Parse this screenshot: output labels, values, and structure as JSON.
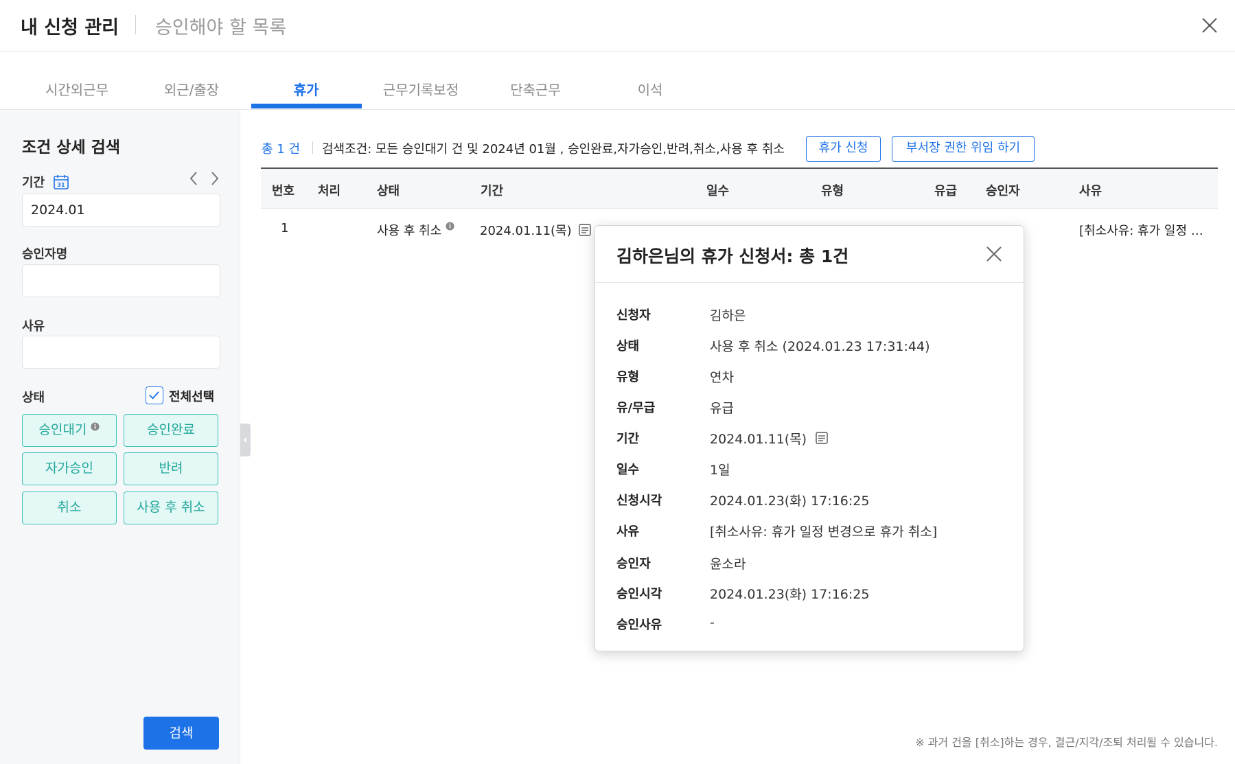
{
  "header": {
    "title": "내 신청 관리",
    "subtitle": "승인해야 할 목록"
  },
  "tabs": [
    {
      "label": "시간외근무"
    },
    {
      "label": "외근/출장"
    },
    {
      "label": "휴가"
    },
    {
      "label": "근무기록보정"
    },
    {
      "label": "단축근무"
    },
    {
      "label": "이석"
    }
  ],
  "sidebar": {
    "title": "조건 상세 검색",
    "period_label": "기간",
    "period_value": "2024.01",
    "approver_label": "승인자명",
    "approver_value": "",
    "reason_label": "사유",
    "reason_value": "",
    "status_label": "상태",
    "select_all_label": "전체선택",
    "status_buttons": [
      "승인대기",
      "승인완료",
      "자가승인",
      "반려",
      "취소",
      "사용 후 취소"
    ],
    "search_label": "검색"
  },
  "summary": {
    "total": "총 1 건",
    "conditions": "검색조건: 모든 승인대기 건 및 2024년 01월 , 승인완료,자가승인,반려,취소,사용 후 취소",
    "leave_request_button": "휴가 신청",
    "delegate_button": "부서장 권한 위임 하기"
  },
  "table": {
    "columns": [
      "번호",
      "처리",
      "상태",
      "기간",
      "일수",
      "유형",
      "유급",
      "승인자",
      "사유"
    ],
    "rows": [
      {
        "no": "1",
        "process": "",
        "status": "사용 후 취소",
        "period": "2024.01.11(목)",
        "reason": "[취소사유: 휴가 일정 …"
      }
    ]
  },
  "footnote": "※ 과거 건을 [취소]하는 경우, 결근/지각/조퇴 처리될 수 있습니다.",
  "modal": {
    "title": "김하은님의 휴가 신청서: 총 1건",
    "fields": [
      {
        "key": "신청자",
        "value": "김하은"
      },
      {
        "key": "상태",
        "value": "사용 후 취소 (2024.01.23 17:31:44)"
      },
      {
        "key": "유형",
        "value": "연차"
      },
      {
        "key": "유/무급",
        "value": "유급"
      },
      {
        "key": "기간",
        "value": "2024.01.11(목)"
      },
      {
        "key": "일수",
        "value": "1일"
      },
      {
        "key": "신청시각",
        "value": "2024.01.23(화) 17:16:25"
      },
      {
        "key": "사유",
        "value": "[취소사유: 휴가 일정 변경으로 휴가 취소]"
      },
      {
        "key": "승인자",
        "value": "윤소라"
      },
      {
        "key": "승인시각",
        "value": "2024.01.23(화) 17:16:25"
      },
      {
        "key": "승인사유",
        "value": "-"
      }
    ]
  },
  "colors": {
    "accent": "#1d72e8",
    "teal": "#3cc3b7",
    "teal_bg": "#e4f8f6"
  }
}
